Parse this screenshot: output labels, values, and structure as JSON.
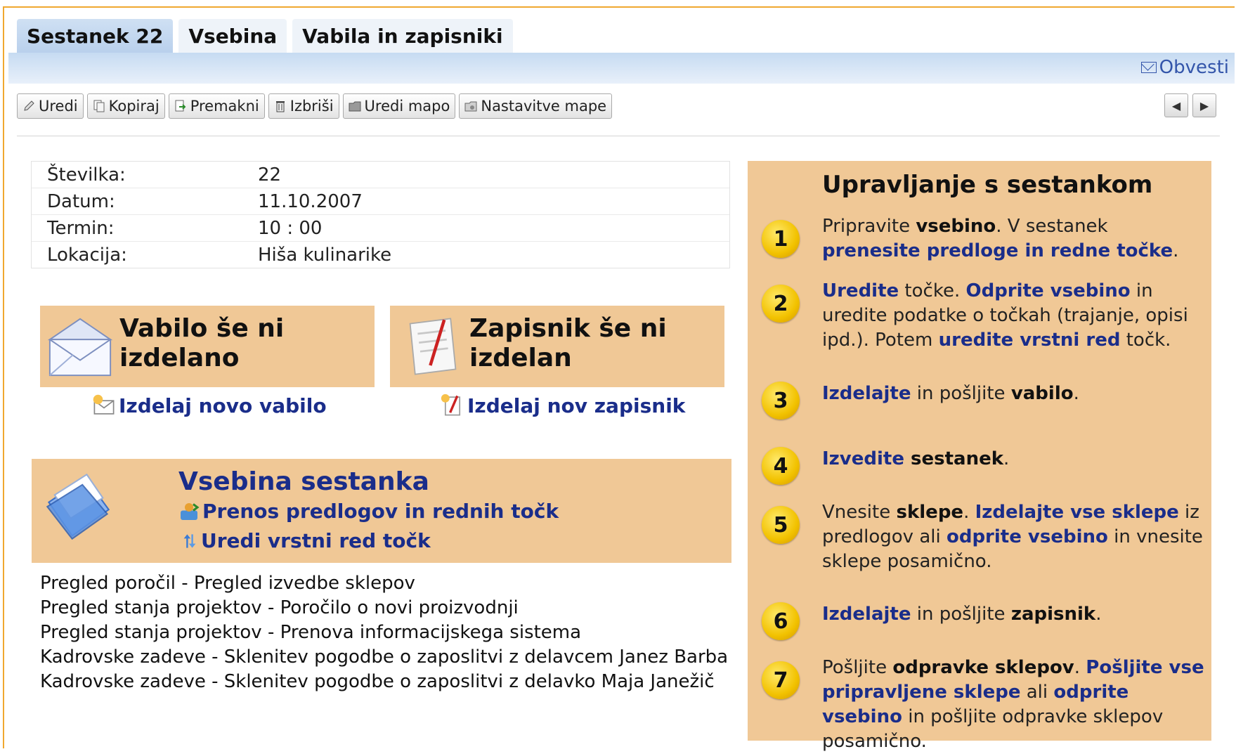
{
  "tabs": [
    "Sestanek 22",
    "Vsebina",
    "Vabila in zapisniki"
  ],
  "notify_label": "Obvesti",
  "toolbar": [
    "Uredi",
    "Kopiraj",
    "Premakni",
    "Izbriši",
    "Uredi mapo",
    "Nastavitve mape"
  ],
  "info": [
    {
      "k": "Številka:",
      "v": "22"
    },
    {
      "k": "Datum:",
      "v": "11.10.2007"
    },
    {
      "k": "Termin:",
      "v": "10 : 00"
    },
    {
      "k": "Lokacija:",
      "v": "Hiša kulinarike"
    }
  ],
  "invitation": {
    "title_1": "Vabilo še ni",
    "title_2": "izdelano",
    "link": "Izdelaj novo vabilo"
  },
  "minutes": {
    "title_1": "Zapisnik še ni",
    "title_2": "izdelan",
    "link": "Izdelaj nov zapisnik"
  },
  "content": {
    "title": "Vsebina sestanka",
    "link_1": "Prenos predlogov in rednih točk",
    "link_2": "Uredi vrstni red točk"
  },
  "agenda": [
    "Pregled poročil - Pregled izvedbe sklepov",
    "Pregled stanja projektov - Poročilo o novi proizvodnji",
    "Pregled stanja projektov - Prenova informacijskega sistema",
    "Kadrovske zadeve - Sklenitev pogodbe o zaposlitvi z delavcem Janez Barba",
    "Kadrovske zadeve - Sklenitev pogodbe o zaposlitvi z delavko Maja Janežič"
  ],
  "panel": {
    "title": "Upravljanje s sestankom",
    "steps": [
      {
        "n": "1",
        "parts": [
          [
            "t",
            "Pripravite "
          ],
          [
            "b",
            "vsebino"
          ],
          [
            "t",
            ". V sestanek "
          ],
          [
            "l",
            "prenesite predloge in redne točke"
          ],
          [
            "t",
            "."
          ]
        ]
      },
      {
        "n": "2",
        "parts": [
          [
            "l",
            "Uredite"
          ],
          [
            "t",
            " točke. "
          ],
          [
            "l",
            "Odprite vsebino"
          ],
          [
            "t",
            " in uredite podatke o točkah (trajanje, opisi ipd.). Potem "
          ],
          [
            "l",
            "uredite vrstni red"
          ],
          [
            "t",
            " točk."
          ]
        ]
      },
      {
        "n": "3",
        "parts": [
          [
            "l",
            "Izdelajte"
          ],
          [
            "t",
            " in pošljite "
          ],
          [
            "b",
            "vabilo"
          ],
          [
            "t",
            "."
          ]
        ]
      },
      {
        "n": "4",
        "parts": [
          [
            "l",
            "Izvedite"
          ],
          [
            "b",
            " sestanek"
          ],
          [
            "t",
            "."
          ]
        ]
      },
      {
        "n": "5",
        "parts": [
          [
            "t",
            "Vnesite "
          ],
          [
            "b",
            "sklepe"
          ],
          [
            "t",
            ". "
          ],
          [
            "l",
            "Izdelajte vse sklepe"
          ],
          [
            "t",
            " iz predlogov ali "
          ],
          [
            "l",
            "odprite vsebino"
          ],
          [
            "t",
            " in vnesite sklepe posamično."
          ]
        ]
      },
      {
        "n": "6",
        "parts": [
          [
            "l",
            "Izdelajte"
          ],
          [
            "t",
            " in pošljite "
          ],
          [
            "b",
            "zapisnik"
          ],
          [
            "t",
            "."
          ]
        ]
      },
      {
        "n": "7",
        "parts": [
          [
            "t",
            "Pošljite "
          ],
          [
            "b",
            "odpravke sklepov"
          ],
          [
            "t",
            ". "
          ],
          [
            "l",
            "Pošljite vse pripravljene sklepe"
          ],
          [
            "t",
            " ali "
          ],
          [
            "l",
            "odprite vsebino"
          ],
          [
            "t",
            " in pošljite odpravke sklepov posamično."
          ]
        ]
      }
    ]
  },
  "colors": {
    "accent_card": "#f0c896",
    "link": "#1a2d8a",
    "tab_active": "#b9d0ec",
    "frame": "#f0a830"
  }
}
